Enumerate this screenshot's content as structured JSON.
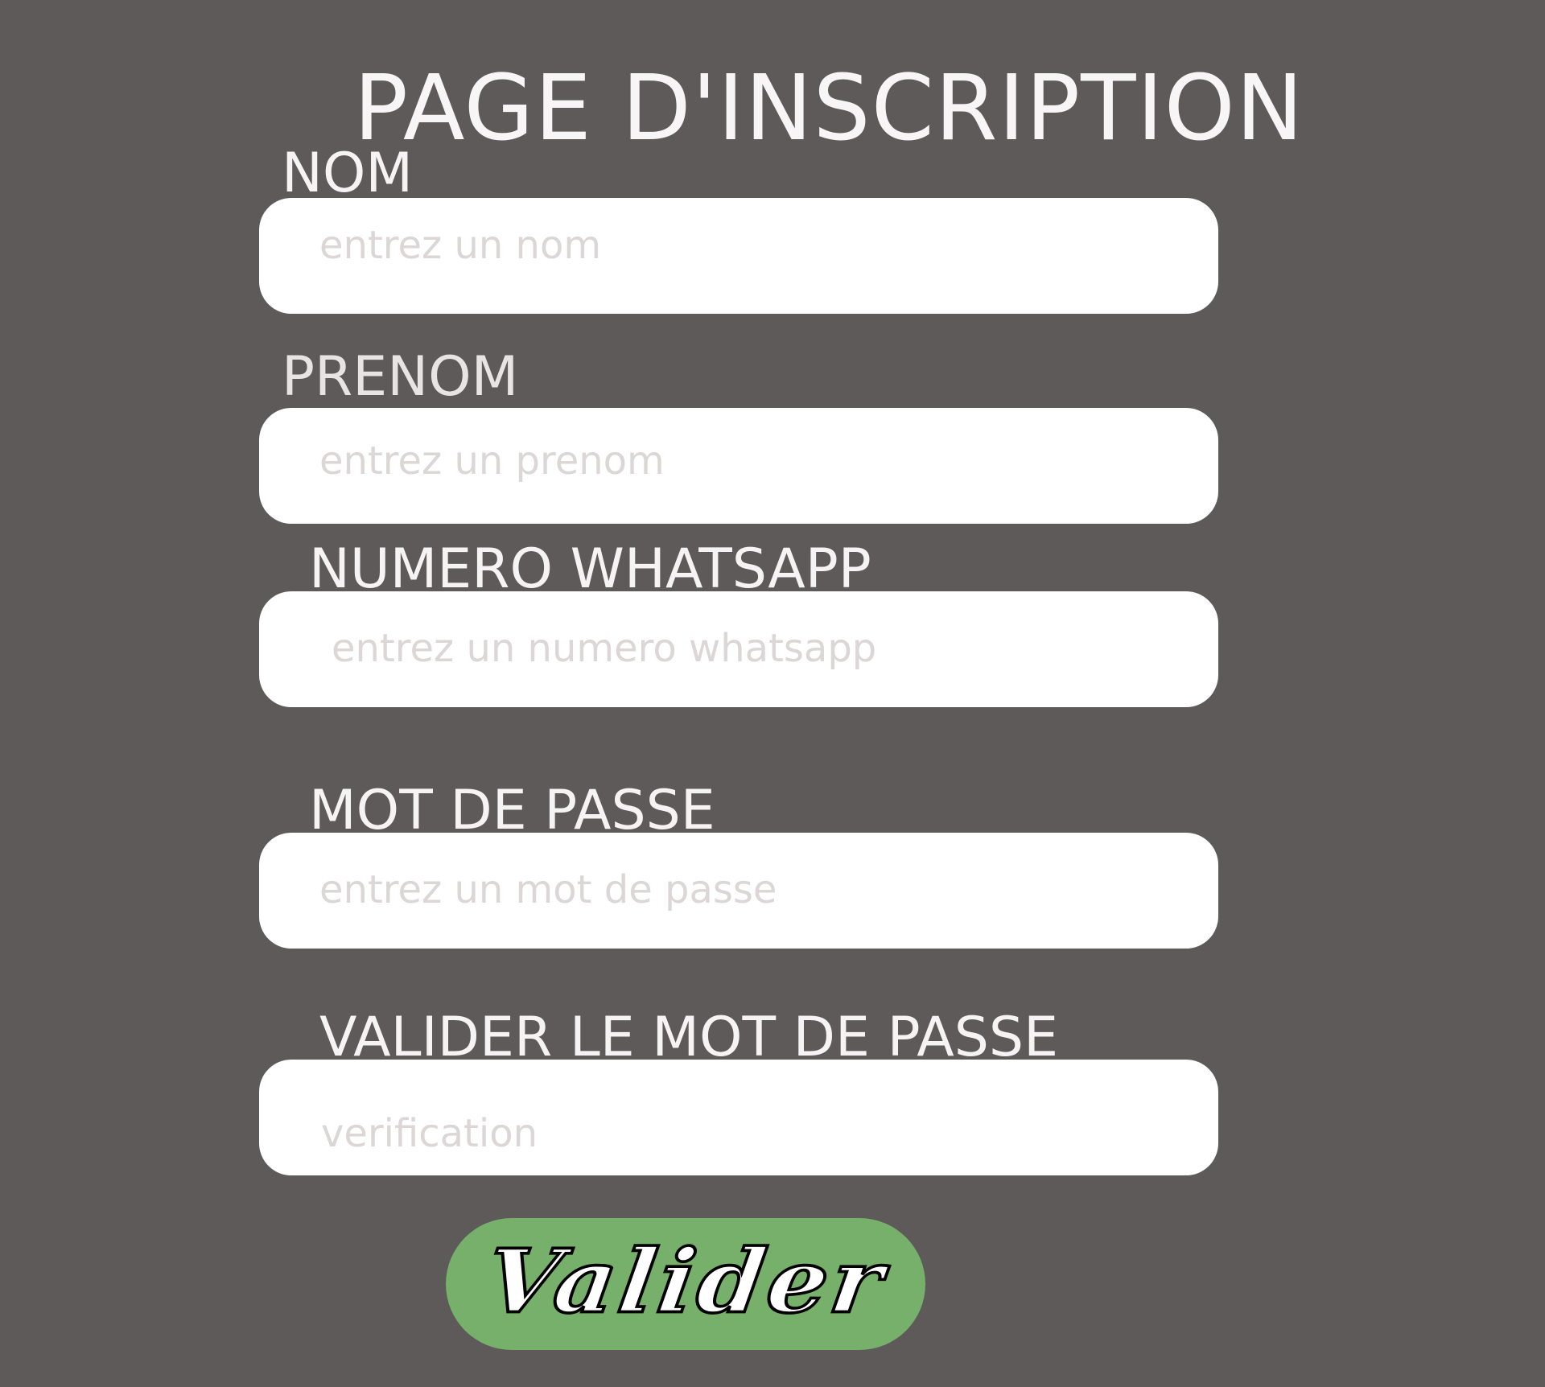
{
  "page": {
    "title": "PAGE D'INSCRIPTION"
  },
  "form": {
    "fields": [
      {
        "label": "NOM",
        "placeholder": "entrez un nom"
      },
      {
        "label": "PRENOM",
        "placeholder": "entrez un prenom"
      },
      {
        "label": "NUMERO WHATSAPP",
        "placeholder": "entrez un numero whatsapp"
      },
      {
        "label": "MOT DE PASSE",
        "placeholder": "entrez un mot de passe"
      },
      {
        "label": "VALIDER LE MOT DE PASSE",
        "placeholder": "verification"
      }
    ],
    "submit_label": "Valider"
  },
  "colors": {
    "background": "#5d5a59",
    "input_background": "#ffffff",
    "placeholder": "#dcd6d6",
    "button": "#76b06a",
    "text": "#f7f5f5"
  }
}
